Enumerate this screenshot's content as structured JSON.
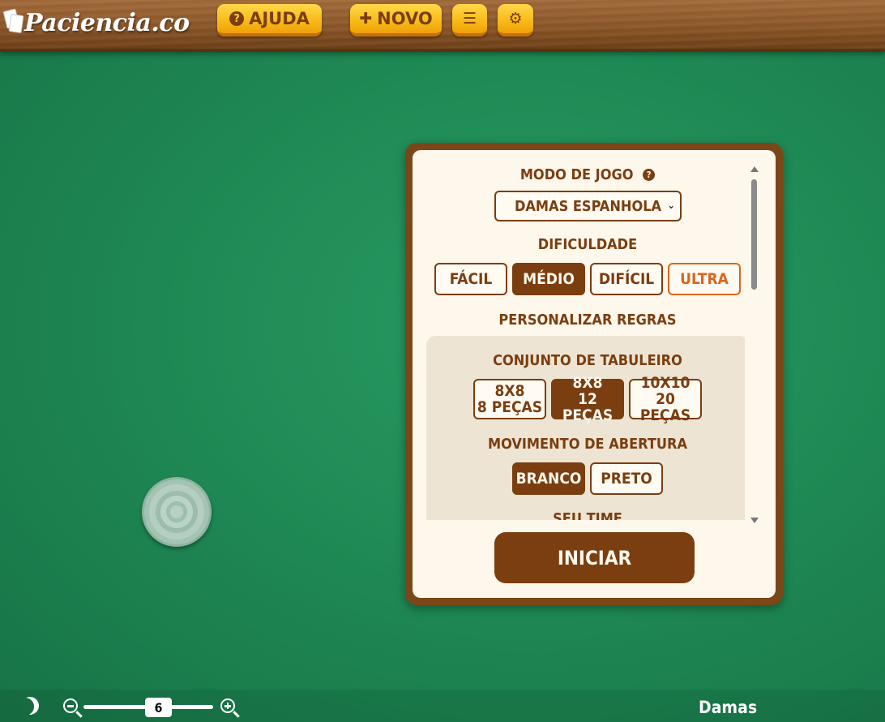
{
  "header": {
    "logo_text": "Paciencia.co",
    "help_label": "AJUDA",
    "new_label": "NOVO"
  },
  "dialog": {
    "game_mode_title": "MODO DE JOGO",
    "game_mode_value": "DAMAS ESPANHOLA",
    "difficulty_title": "DIFICULDADE",
    "difficulty_options": [
      "FÁCIL",
      "MÉDIO",
      "DIFÍCIL",
      "ULTRA"
    ],
    "difficulty_selected": "MÉDIO",
    "customize_title": "PERSONALIZAR REGRAS",
    "board_set_title": "CONJUNTO DE TABULEIRO",
    "board_options": [
      {
        "line1": "8X8",
        "line2": "8 PEÇAS"
      },
      {
        "line1": "8X8",
        "line2": "12 PEÇAS"
      },
      {
        "line1": "10X10",
        "line2": "20 PEÇAS"
      }
    ],
    "board_selected": "8X8 12 PEÇAS",
    "opening_move_title": "MOVIMENTO DE ABERTURA",
    "opening_options": [
      "BRANCO",
      "PRETO"
    ],
    "opening_selected": "BRANCO",
    "team_title": "SEU TIME",
    "start_label": "INICIAR"
  },
  "footer": {
    "zoom_value": "6",
    "game_name": "Damas"
  },
  "colors": {
    "felt": "#1f8a55",
    "wood": "#8a5628",
    "accent_brown": "#7a3e10",
    "ultra_orange": "#d9661b",
    "button_yellow": "#f8b916"
  },
  "icons": [
    "help-icon",
    "plus-icon",
    "menu-icon",
    "gear-icon",
    "moon-icon",
    "zoom-out-icon",
    "zoom-in-icon"
  ]
}
